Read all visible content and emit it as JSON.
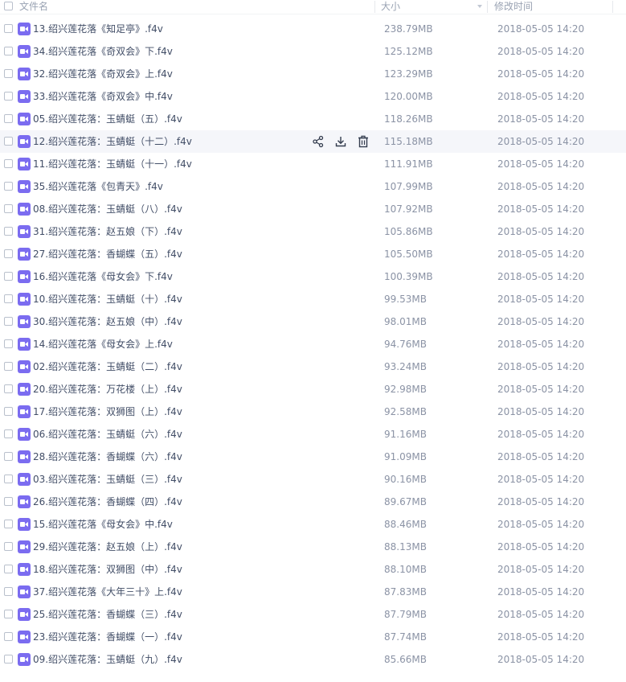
{
  "header": {
    "name": "文件名",
    "size": "大小",
    "time": "修改时间"
  },
  "icons": {
    "file": "video-file-icon",
    "share": "share-icon",
    "download": "download-icon",
    "delete": "trash-icon"
  },
  "colors": {
    "accent": "#7b6cf0",
    "hover_row": "#f5f6fa"
  },
  "hover_index": 5,
  "rows": [
    {
      "name": "13.绍兴莲花落《知足亭》.f4v",
      "size": "238.79MB",
      "time": "2018-05-05 14:20"
    },
    {
      "name": "34.绍兴莲花落《奇双会》下.f4v",
      "size": "125.12MB",
      "time": "2018-05-05 14:20"
    },
    {
      "name": "32.绍兴莲花落《奇双会》上.f4v",
      "size": "123.29MB",
      "time": "2018-05-05 14:20"
    },
    {
      "name": "33.绍兴莲花落《奇双会》中.f4v",
      "size": "120.00MB",
      "time": "2018-05-05 14:20"
    },
    {
      "name": "05.绍兴莲花落：玉蜻蜓（五）.f4v",
      "size": "118.26MB",
      "time": "2018-05-05 14:20"
    },
    {
      "name": "12.绍兴莲花落：玉蜻蜓（十二）.f4v",
      "size": "115.18MB",
      "time": "2018-05-05 14:20"
    },
    {
      "name": "11.绍兴莲花落：玉蜻蜓（十一）.f4v",
      "size": "111.91MB",
      "time": "2018-05-05 14:20"
    },
    {
      "name": "35.绍兴莲花落《包青天》.f4v",
      "size": "107.99MB",
      "time": "2018-05-05 14:20"
    },
    {
      "name": "08.绍兴莲花落：玉蜻蜓（八）.f4v",
      "size": "107.92MB",
      "time": "2018-05-05 14:20"
    },
    {
      "name": "31.绍兴莲花落：赵五娘（下）.f4v",
      "size": "105.86MB",
      "time": "2018-05-05 14:20"
    },
    {
      "name": "27.绍兴莲花落：香蝴蝶（五）.f4v",
      "size": "105.50MB",
      "time": "2018-05-05 14:20"
    },
    {
      "name": "16.绍兴莲花落《母女会》下.f4v",
      "size": "100.39MB",
      "time": "2018-05-05 14:20"
    },
    {
      "name": "10.绍兴莲花落：玉蜻蜓（十）.f4v",
      "size": "99.53MB",
      "time": "2018-05-05 14:20"
    },
    {
      "name": "30.绍兴莲花落：赵五娘（中）.f4v",
      "size": "98.01MB",
      "time": "2018-05-05 14:20"
    },
    {
      "name": "14.绍兴莲花落《母女会》上.f4v",
      "size": "94.76MB",
      "time": "2018-05-05 14:20"
    },
    {
      "name": "02.绍兴莲花落：玉蜻蜓（二）.f4v",
      "size": "93.24MB",
      "time": "2018-05-05 14:20"
    },
    {
      "name": "20.绍兴莲花落：万花楼（上）.f4v",
      "size": "92.98MB",
      "time": "2018-05-05 14:20"
    },
    {
      "name": "17.绍兴莲花落：双狮图（上）.f4v",
      "size": "92.58MB",
      "time": "2018-05-05 14:20"
    },
    {
      "name": "06.绍兴莲花落：玉蜻蜓（六）.f4v",
      "size": "91.16MB",
      "time": "2018-05-05 14:20"
    },
    {
      "name": "28.绍兴莲花落：香蝴蝶（六）.f4v",
      "size": "91.09MB",
      "time": "2018-05-05 14:20"
    },
    {
      "name": "03.绍兴莲花落：玉蜻蜓（三）.f4v",
      "size": "90.16MB",
      "time": "2018-05-05 14:20"
    },
    {
      "name": "26.绍兴莲花落：香蝴蝶（四）.f4v",
      "size": "89.67MB",
      "time": "2018-05-05 14:20"
    },
    {
      "name": "15.绍兴莲花落《母女会》中.f4v",
      "size": "88.46MB",
      "time": "2018-05-05 14:20"
    },
    {
      "name": "29.绍兴莲花落：赵五娘（上）.f4v",
      "size": "88.13MB",
      "time": "2018-05-05 14:20"
    },
    {
      "name": "18.绍兴莲花落：双狮图（中）.f4v",
      "size": "88.10MB",
      "time": "2018-05-05 14:20"
    },
    {
      "name": "37.绍兴莲花落《大年三十》上.f4v",
      "size": "87.83MB",
      "time": "2018-05-05 14:20"
    },
    {
      "name": "25.绍兴莲花落：香蝴蝶（三）.f4v",
      "size": "87.79MB",
      "time": "2018-05-05 14:20"
    },
    {
      "name": "23.绍兴莲花落：香蝴蝶（一）.f4v",
      "size": "87.74MB",
      "time": "2018-05-05 14:20"
    },
    {
      "name": "09.绍兴莲花落：玉蜻蜓（九）.f4v",
      "size": "85.66MB",
      "time": "2018-05-05 14:20"
    }
  ]
}
